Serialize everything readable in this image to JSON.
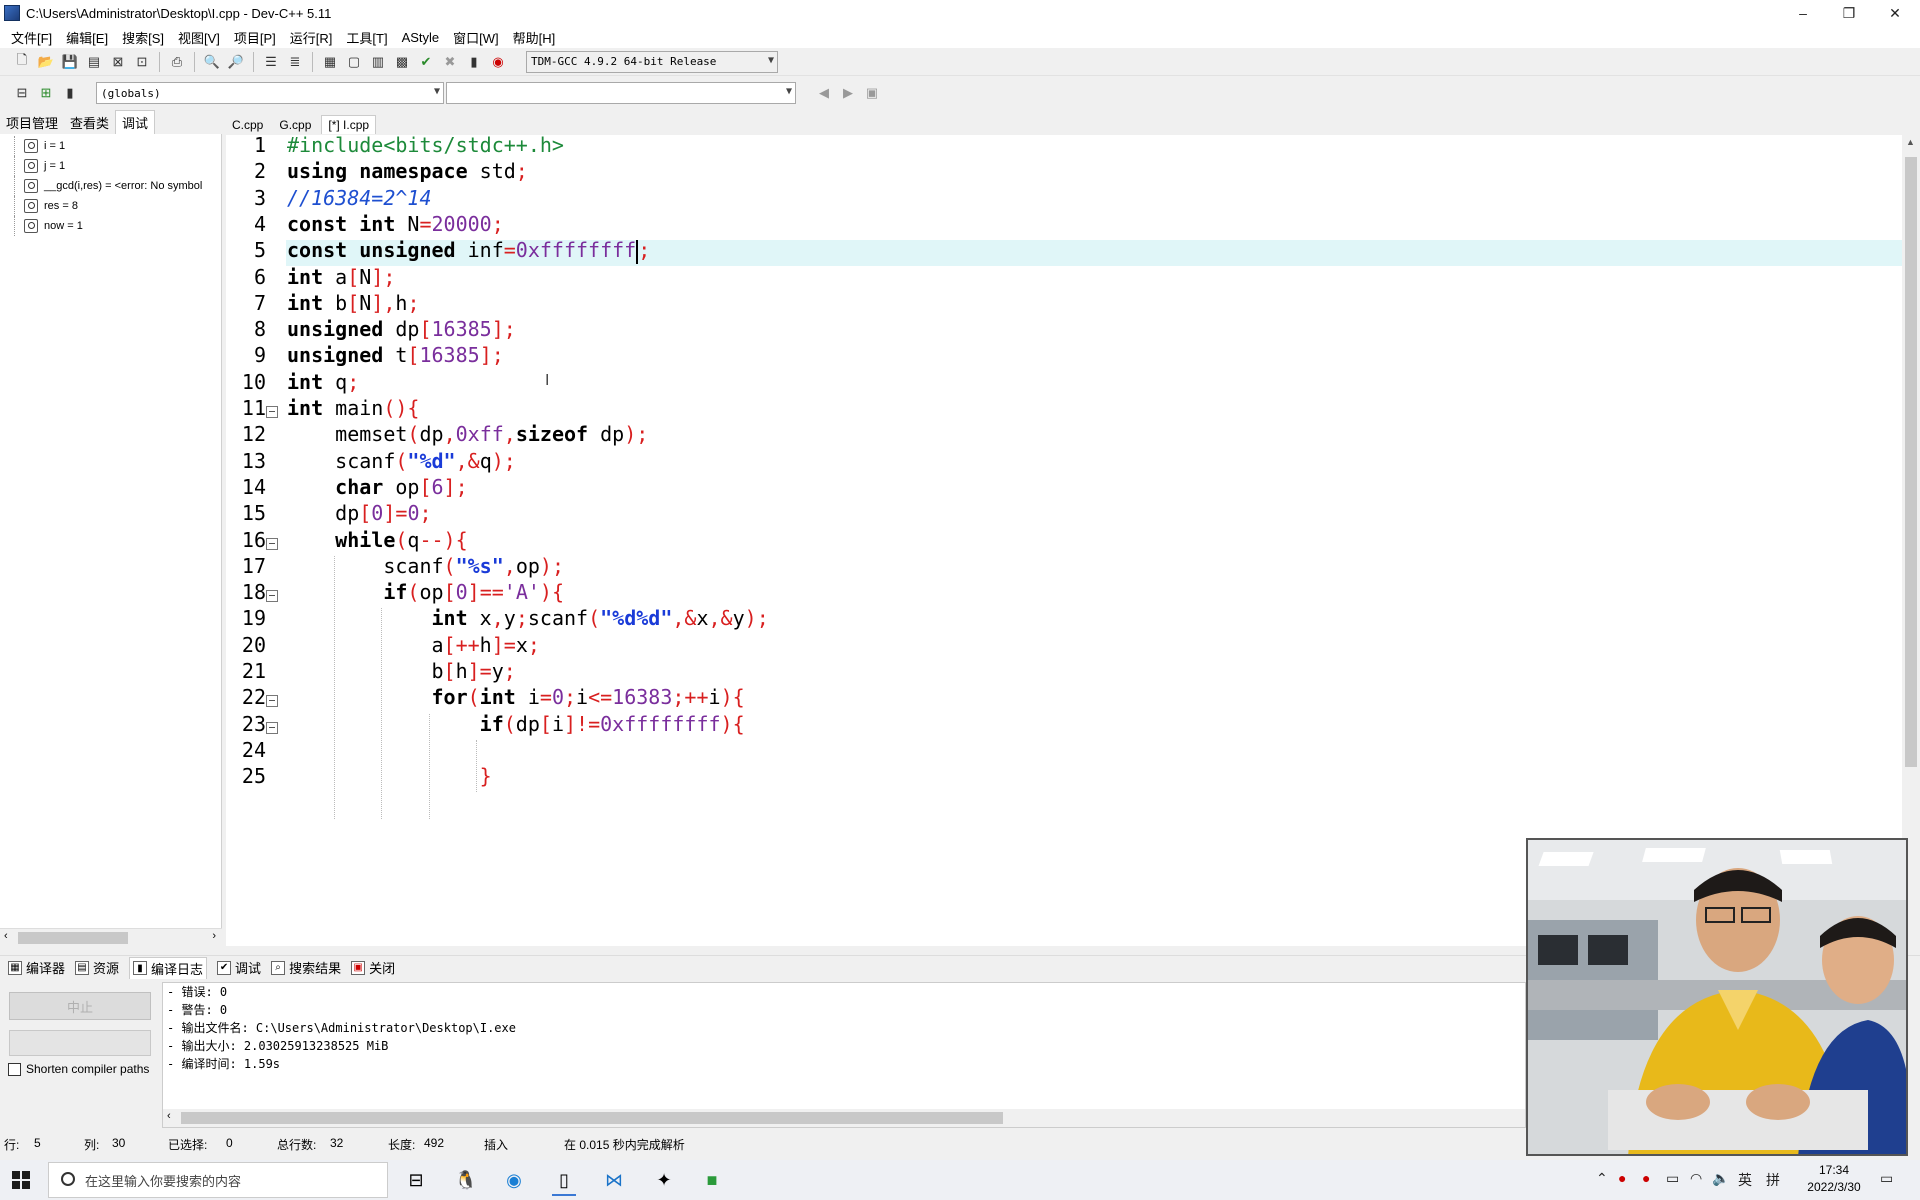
{
  "window": {
    "title": "C:\\Users\\Administrator\\Desktop\\I.cpp - Dev-C++ 5.11",
    "controls": [
      "–",
      "❐",
      "✕"
    ]
  },
  "menu": [
    "文件[F]",
    "编辑[E]",
    "搜索[S]",
    "视图[V]",
    "项目[P]",
    "运行[R]",
    "工具[T]",
    "AStyle",
    "窗口[W]",
    "帮助[H]"
  ],
  "toolbar": {
    "compiler": "TDM-GCC 4.9.2 64-bit Release",
    "scope": "(globals)",
    "symbol": ""
  },
  "left_panel": {
    "tabs": [
      "项目管理",
      "查看类",
      "调试"
    ],
    "active_tab": "调试",
    "watches": [
      "i = 1",
      "j = 1",
      "__gcd(i,res) = <error: No symbol",
      "res = 8",
      "now = 1"
    ]
  },
  "editor": {
    "tabs": [
      "C.cpp",
      "G.cpp",
      "[*] I.cpp"
    ],
    "active_tab": "[*] I.cpp",
    "line_numbers": [
      "1",
      "2",
      "3",
      "4",
      "5",
      "6",
      "7",
      "8",
      "9",
      "10",
      "11",
      "12",
      "13",
      "14",
      "15",
      "16",
      "17",
      "18",
      "19",
      "20",
      "21",
      "22",
      "23",
      "24",
      "25"
    ],
    "current_line": 5,
    "lines": [
      [
        [
          "pp",
          "#include<bits/stdc++.h>"
        ]
      ],
      [
        [
          "kw",
          "using namespace"
        ],
        [
          "tx",
          " std"
        ],
        [
          "op",
          ";"
        ]
      ],
      [
        [
          "cm",
          "//16384=2^14"
        ]
      ],
      [
        [
          "kw",
          "const int"
        ],
        [
          "tx",
          " N"
        ],
        [
          "op",
          "="
        ],
        [
          "nm",
          "20000"
        ],
        [
          "op",
          ";"
        ]
      ],
      [
        [
          "kw",
          "const unsigned"
        ],
        [
          "tx",
          " inf"
        ],
        [
          "op",
          "="
        ],
        [
          "nm",
          "0xffffffff"
        ],
        [
          "caret",
          ""
        ],
        [
          "op",
          ";"
        ]
      ],
      [
        [
          "kw",
          "int"
        ],
        [
          "tx",
          " a"
        ],
        [
          "op",
          "["
        ],
        [
          "tx",
          "N"
        ],
        [
          "op",
          "];"
        ]
      ],
      [
        [
          "kw",
          "int"
        ],
        [
          "tx",
          " b"
        ],
        [
          "op",
          "["
        ],
        [
          "tx",
          "N"
        ],
        [
          "op",
          "],"
        ],
        [
          "tx",
          "h"
        ],
        [
          "op",
          ";"
        ]
      ],
      [
        [
          "kw",
          "unsigned"
        ],
        [
          "tx",
          " dp"
        ],
        [
          "op",
          "["
        ],
        [
          "nm",
          "16385"
        ],
        [
          "op",
          "];"
        ]
      ],
      [
        [
          "kw",
          "unsigned"
        ],
        [
          "tx",
          " t"
        ],
        [
          "op",
          "["
        ],
        [
          "nm",
          "16385"
        ],
        [
          "op",
          "];"
        ]
      ],
      [
        [
          "kw",
          "int"
        ],
        [
          "tx",
          " q"
        ],
        [
          "op",
          ";"
        ]
      ],
      [
        [
          "kw",
          "int"
        ],
        [
          "tx",
          " main"
        ],
        [
          "op",
          "(){"
        ]
      ],
      [
        [
          "tx",
          "    memset"
        ],
        [
          "op",
          "("
        ],
        [
          "tx",
          "dp"
        ],
        [
          "op",
          ","
        ],
        [
          "nm",
          "0xff"
        ],
        [
          "op",
          ","
        ],
        [
          "kw",
          "sizeof"
        ],
        [
          "tx",
          " dp"
        ],
        [
          "op",
          ");"
        ]
      ],
      [
        [
          "tx",
          "    scanf"
        ],
        [
          "op",
          "("
        ],
        [
          "st",
          "\"%d\""
        ],
        [
          "op",
          ",&"
        ],
        [
          "tx",
          "q"
        ],
        [
          "op",
          ");"
        ]
      ],
      [
        [
          "kw",
          "    char"
        ],
        [
          "tx",
          " op"
        ],
        [
          "op",
          "["
        ],
        [
          "nm",
          "6"
        ],
        [
          "op",
          "];"
        ]
      ],
      [
        [
          "tx",
          "    dp"
        ],
        [
          "op",
          "["
        ],
        [
          "nm",
          "0"
        ],
        [
          "op",
          "]="
        ],
        [
          "nm",
          "0"
        ],
        [
          "op",
          ";"
        ]
      ],
      [
        [
          "kw",
          "    while"
        ],
        [
          "op",
          "("
        ],
        [
          "tx",
          "q"
        ],
        [
          "op",
          "--){"
        ]
      ],
      [
        [
          "tx",
          "        scanf"
        ],
        [
          "op",
          "("
        ],
        [
          "st",
          "\"%s\""
        ],
        [
          "op",
          ","
        ],
        [
          "tx",
          "op"
        ],
        [
          "op",
          ");"
        ]
      ],
      [
        [
          "kw",
          "        if"
        ],
        [
          "op",
          "("
        ],
        [
          "tx",
          "op"
        ],
        [
          "op",
          "["
        ],
        [
          "nm",
          "0"
        ],
        [
          "op",
          "]=="
        ],
        [
          "nm",
          "'A'"
        ],
        [
          "op",
          "){"
        ]
      ],
      [
        [
          "kw",
          "            int"
        ],
        [
          "tx",
          " x"
        ],
        [
          "op",
          ","
        ],
        [
          "tx",
          "y"
        ],
        [
          "op",
          ";"
        ],
        [
          "tx",
          "scanf"
        ],
        [
          "op",
          "("
        ],
        [
          "st",
          "\"%d%d\""
        ],
        [
          "op",
          ",&"
        ],
        [
          "tx",
          "x"
        ],
        [
          "op",
          ",&"
        ],
        [
          "tx",
          "y"
        ],
        [
          "op",
          ");"
        ]
      ],
      [
        [
          "tx",
          "            a"
        ],
        [
          "op",
          "[++"
        ],
        [
          "tx",
          "h"
        ],
        [
          "op",
          "]="
        ],
        [
          "tx",
          "x"
        ],
        [
          "op",
          ";"
        ]
      ],
      [
        [
          "tx",
          "            b"
        ],
        [
          "op",
          "["
        ],
        [
          "tx",
          "h"
        ],
        [
          "op",
          "]="
        ],
        [
          "tx",
          "y"
        ],
        [
          "op",
          ";"
        ]
      ],
      [
        [
          "kw",
          "            for"
        ],
        [
          "op",
          "("
        ],
        [
          "kw",
          "int"
        ],
        [
          "tx",
          " i"
        ],
        [
          "op",
          "="
        ],
        [
          "nm",
          "0"
        ],
        [
          "op",
          ";"
        ],
        [
          "tx",
          "i"
        ],
        [
          "op",
          "<="
        ],
        [
          "nm",
          "16383"
        ],
        [
          "op",
          ";++"
        ],
        [
          "tx",
          "i"
        ],
        [
          "op",
          "){"
        ]
      ],
      [
        [
          "kw",
          "                if"
        ],
        [
          "op",
          "("
        ],
        [
          "tx",
          "dp"
        ],
        [
          "op",
          "["
        ],
        [
          "tx",
          "i"
        ],
        [
          "op",
          "]!="
        ],
        [
          "nm",
          "0xffffffff"
        ],
        [
          "op",
          "){"
        ]
      ],
      [
        [
          "tx",
          ""
        ]
      ],
      [
        [
          "op",
          "                }"
        ]
      ]
    ]
  },
  "bottom": {
    "tabs": [
      "编译器",
      "资源",
      "编译日志",
      "调试",
      "搜索结果",
      "关闭"
    ],
    "active_tab": "编译日志",
    "stop_button": "中止",
    "shorten_label": "Shorten compiler paths",
    "log": [
      "- 错误: 0",
      "- 警告: 0",
      "- 输出文件名: C:\\Users\\Administrator\\Desktop\\I.exe",
      "- 输出大小: 2.03025913238525 MiB",
      "- 编译时间: 1.59s"
    ]
  },
  "status": {
    "row_label": "行:",
    "row": "5",
    "col_label": "列:",
    "col": "30",
    "sel_label": "已选择:",
    "sel": "0",
    "lines_label": "总行数:",
    "lines": "32",
    "len_label": "长度:",
    "len": "492",
    "mode": "插入",
    "parse": "在 0.015 秒内完成解析"
  },
  "taskbar": {
    "search_placeholder": "在这里输入你要搜索的内容",
    "time": "17:34",
    "date": "2022/3/30",
    "ime": "英",
    "ime2": "拼"
  }
}
